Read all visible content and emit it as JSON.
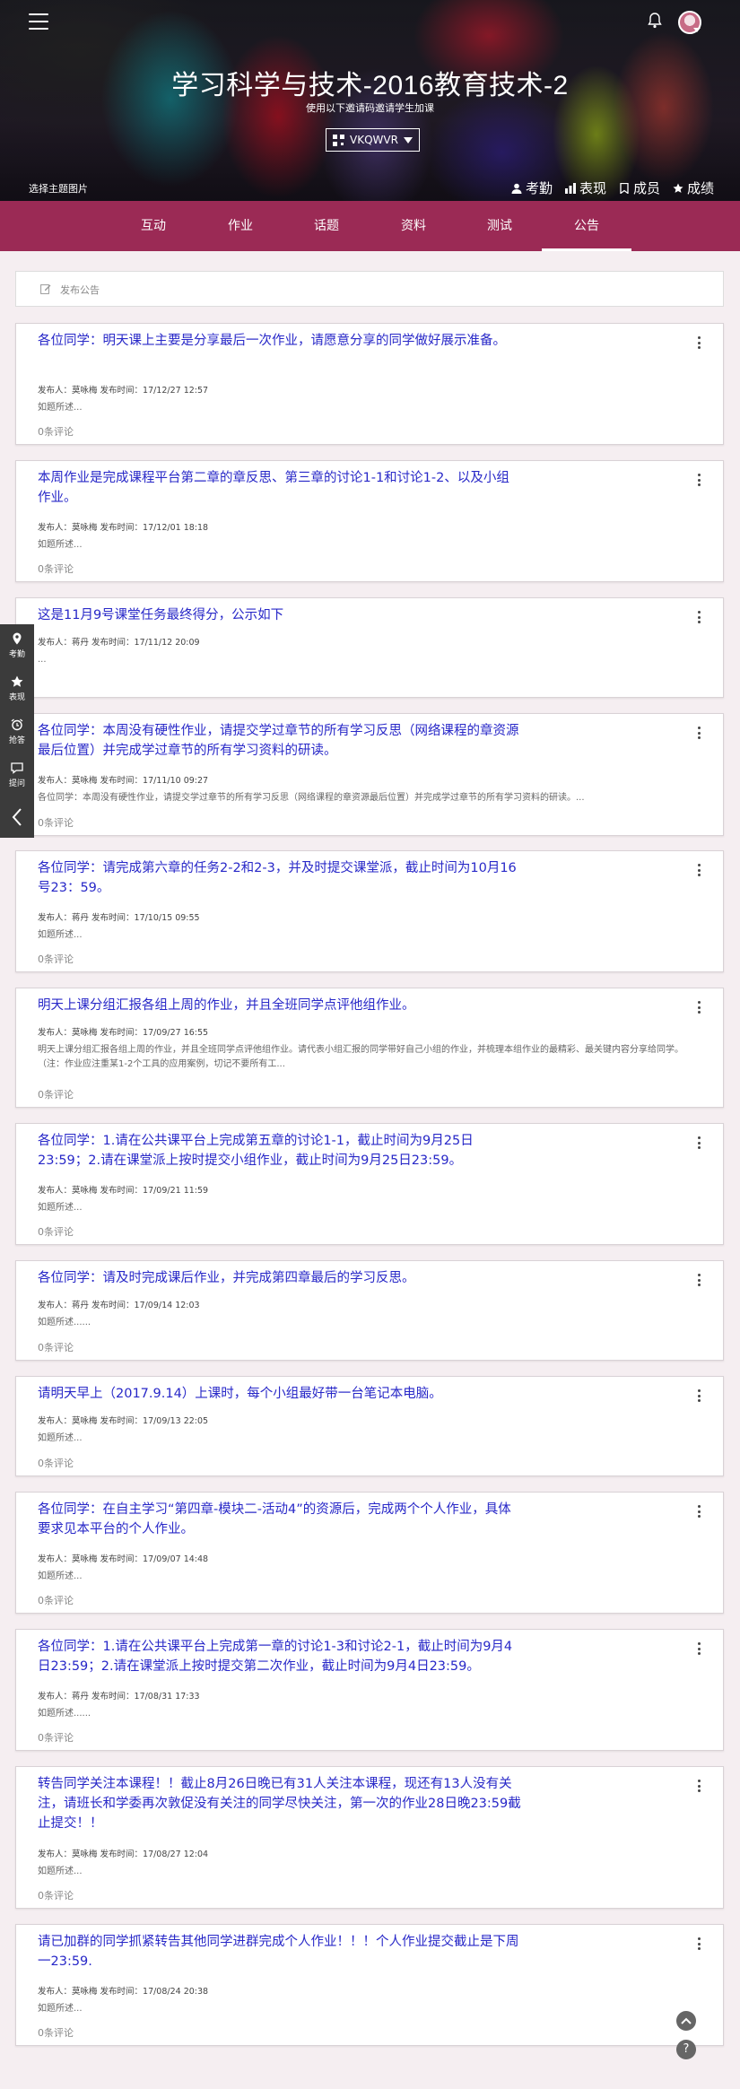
{
  "header": {
    "title": "学习科学与技术-2016教育技术-2",
    "subtitle": "使用以下邀请码邀请学生加课",
    "invite_code": "VKQWVR",
    "choose_bg": "选择主题图片",
    "links": [
      "考勤",
      "表现",
      "成员",
      "成绩"
    ]
  },
  "nav": {
    "tabs": [
      "互动",
      "作业",
      "话题",
      "资料",
      "测试",
      "公告"
    ],
    "active": "公告"
  },
  "post_box": {
    "label": "发布公告"
  },
  "side_toolbar": [
    "考勤",
    "表现",
    "抢答",
    "提问"
  ],
  "announcements": [
    {
      "title": "各位同学：明天课上主要是分享最后一次作业，请愿意分享的同学做好展示准备。",
      "meta": "发布人：莫咏梅 发布时间：17/12/27 12:57",
      "summary": "如题所述...",
      "comments": "0条评论"
    },
    {
      "title": "本周作业是完成课程平台第二章的章反思、第三章的讨论1-1和讨论1-2、以及小组作业。",
      "meta": "发布人：莫咏梅 发布时间：17/12/01 18:18",
      "summary": "如题所述...",
      "comments": "0条评论"
    },
    {
      "title": "这是11月9号课堂任务最终得分，公示如下",
      "meta": "发布人：蒋丹 发布时间：17/11/12 20:09",
      "summary": "...",
      "comments": ""
    },
    {
      "title": "各位同学：本周没有硬性作业，请提交学过章节的所有学习反思（网络课程的章资源最后位置）并完成学过章节的所有学习资料的研读。",
      "meta": "发布人：莫咏梅 发布时间：17/11/10 09:27",
      "summary": "各位同学：本周没有硬性作业，请提交学过章节的所有学习反思（网络课程的章资源最后位置）并完成学过章节的所有学习资料的研读。...",
      "comments": "0条评论"
    },
    {
      "title": "各位同学：请完成第六章的任务2-2和2-3，并及时提交课堂派，截止时间为10月16号23：59。",
      "meta": "发布人：蒋丹 发布时间：17/10/15 09:55",
      "summary": "如题所述...",
      "comments": "0条评论"
    },
    {
      "title": "明天上课分组汇报各组上周的作业，并且全班同学点评他组作业。",
      "meta": "发布人：莫咏梅 发布时间：17/09/27 16:55",
      "summary": "明天上课分组汇报各组上周的作业，并且全班同学点评他组作业。请代表小组汇报的同学带好自己小组的作业，并梳理本组作业的最精彩、最关键内容分享给同学。（注：作业应注重某1-2个工具的应用案例，切记不要所有工...",
      "comments": "0条评论"
    },
    {
      "title": "各位同学：1.请在公共课平台上完成第五章的讨论1-1，截止时间为9月25日23:59；2.请在课堂派上按时提交小组作业，截止时间为9月25日23:59。",
      "meta": "发布人：莫咏梅 发布时间：17/09/21 11:59",
      "summary": "如题所述...",
      "comments": "0条评论"
    },
    {
      "title": "各位同学：请及时完成课后作业，并完成第四章最后的学习反思。",
      "meta": "发布人：蒋丹 发布时间：17/09/14 12:03",
      "summary": "如题所述......",
      "comments": "0条评论"
    },
    {
      "title": "请明天早上（2017.9.14）上课时，每个小组最好带一台笔记本电脑。",
      "meta": "发布人：莫咏梅 发布时间：17/09/13 22:05",
      "summary": "如题所述...",
      "comments": "0条评论"
    },
    {
      "title": "各位同学：在自主学习“第四章-模块二-活动4”的资源后，完成两个个人作业，具体要求见本平台的个人作业。",
      "meta": "发布人：莫咏梅 发布时间：17/09/07 14:48",
      "summary": "如题所述...",
      "comments": "0条评论"
    },
    {
      "title": "各位同学：1.请在公共课平台上完成第一章的讨论1-3和讨论2-1，截止时间为9月4日23:59；2.请在课堂派上按时提交第二次作业，截止时间为9月4日23:59。",
      "meta": "发布人：蒋丹 发布时间：17/08/31 17:33",
      "summary": "如题所述......",
      "comments": "0条评论"
    },
    {
      "title": "转告同学关注本课程！！截止8月26日晚已有31人关注本课程，现还有13人没有关注，请班长和学委再次敦促没有关注的同学尽快关注，第一次的作业28日晚23:59截止提交！！",
      "meta": "发布人：莫咏梅 发布时间：17/08/27 12:04",
      "summary": "如题所述...",
      "comments": "0条评论"
    },
    {
      "title": "请已加群的同学抓紧转告其他同学进群完成个人作业！！！个人作业提交截止是下周一23:59.",
      "meta": "发布人：莫咏梅 发布时间：17/08/24 20:38",
      "summary": "如题所述...",
      "comments": "0条评论"
    }
  ],
  "float_buttons": [
    "^",
    "?"
  ]
}
